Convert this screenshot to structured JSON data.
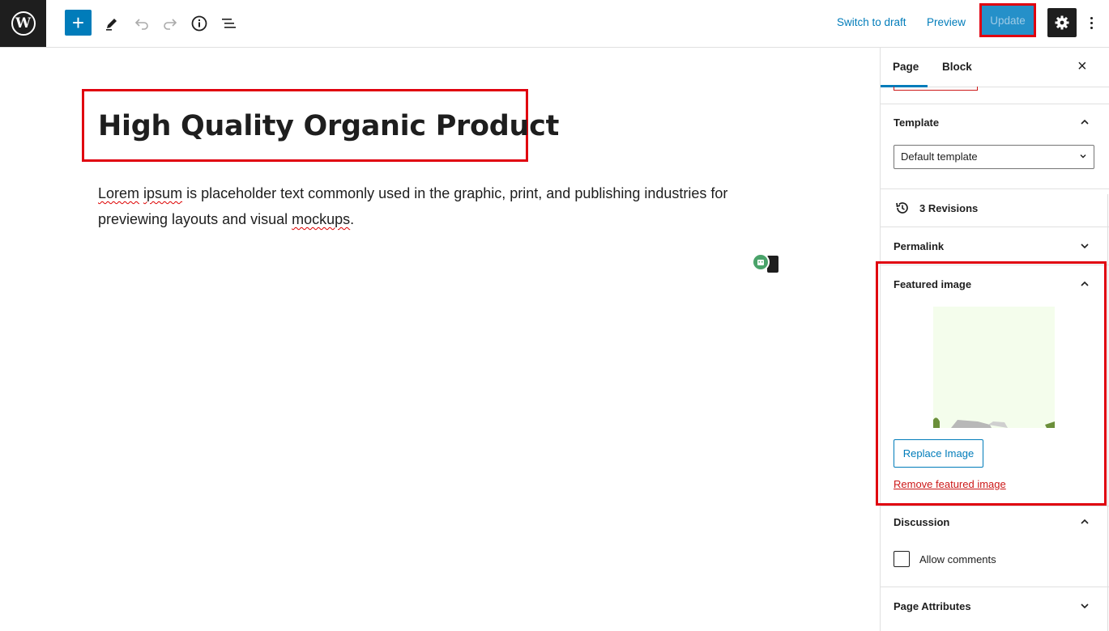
{
  "toolbar": {
    "logo_glyph": "W",
    "add_symbol": "+",
    "switch_to_draft": "Switch to draft",
    "preview": "Preview",
    "update": "Update"
  },
  "editor": {
    "title": "High Quality Organic Product",
    "paragraph": {
      "w1": "Lorem",
      "w2": "ipsum",
      "mid": " is placeholder text commonly used in the graphic, print, and publishing industries for previewing layouts and visual ",
      "w3": "mockups",
      "end": "."
    }
  },
  "sidebar": {
    "tabs": {
      "page": "Page",
      "block": "Block"
    },
    "close_symbol": "×",
    "template": {
      "title": "Template",
      "value": "Default template"
    },
    "revisions": "3 Revisions",
    "permalink": "Permalink",
    "featured_image": {
      "title": "Featured image",
      "replace": "Replace Image",
      "remove": "Remove featured image"
    },
    "discussion": {
      "title": "Discussion",
      "allow_comments": "Allow comments"
    },
    "page_attributes": "Page Attributes"
  },
  "colors": {
    "accent": "#007cba",
    "highlight": "#e0000f",
    "danger": "#cc1818",
    "dark": "#1e1e1e"
  },
  "icons": [
    "wordpress-logo-icon",
    "plus-icon",
    "pencil-icon",
    "undo-icon",
    "redo-icon",
    "info-icon",
    "list-view-icon",
    "gear-icon",
    "kebab-icon",
    "close-icon",
    "chevron-up-icon",
    "chevron-down-icon",
    "revisions-icon",
    "bot-icon"
  ]
}
